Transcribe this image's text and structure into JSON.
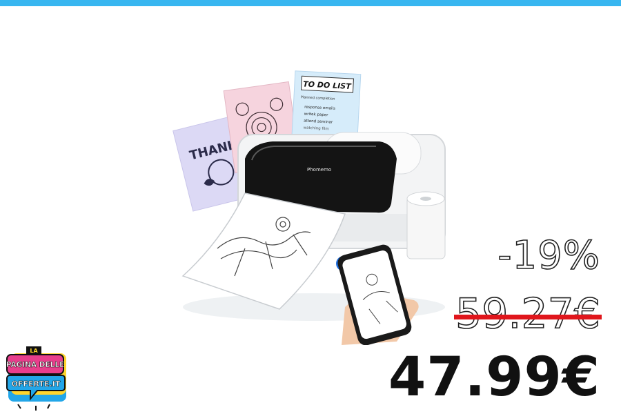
{
  "banner": {
    "accent_color": "#38b6f0"
  },
  "product": {
    "image_icon": "thermal-printer-photo",
    "paper_samples": {
      "todo_title": "TO DO LIST",
      "todo_subtitle": "Planned completion",
      "todo_items": [
        "response emails",
        "writek paper",
        "attend seminar",
        "watching film"
      ],
      "thank_text": "THANK",
      "brand_on_printer": "Phomemo"
    }
  },
  "pricing": {
    "discount": "-19%",
    "old_price": "59.27€",
    "new_price": "47.99€",
    "strike_color": "#e0161c"
  },
  "logo": {
    "line1": "LA",
    "line2": "PAGINA DELLE",
    "line3": "OFFERTE.IT"
  }
}
